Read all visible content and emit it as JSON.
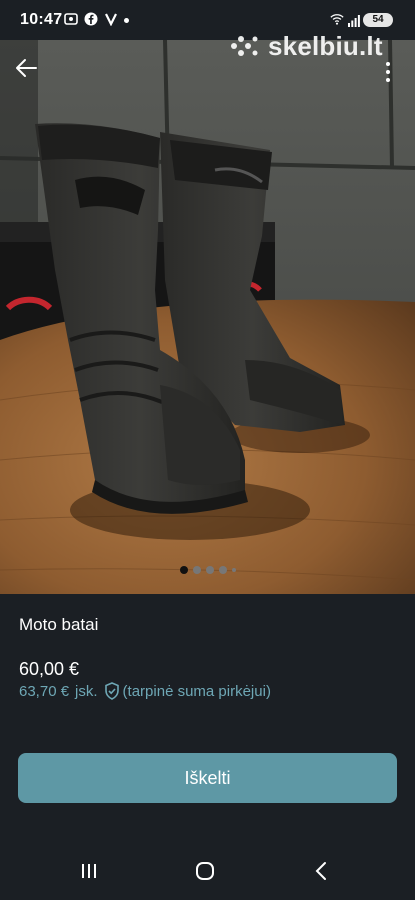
{
  "status_bar": {
    "time": "10:47",
    "battery": "54"
  },
  "brand": {
    "name": "skelbiu.lt"
  },
  "listing": {
    "title": "Moto batai",
    "price": "60,00 €",
    "protected_price": "63,70 €",
    "protected_suffix": "jsk.",
    "protected_note": "(tarpinė suma pirkėjui)"
  },
  "gallery": {
    "total_dots": 5,
    "active_index": 1
  },
  "actions": {
    "primary": "Iškelti"
  },
  "colors": {
    "background": "#1b1f24",
    "accent": "#5e98a5",
    "accent_text": "#6ea7b5"
  },
  "icons": [
    "back-arrow-icon",
    "more-vert-icon",
    "shield-check-icon",
    "recent-apps-icon",
    "home-icon",
    "back-icon"
  ]
}
